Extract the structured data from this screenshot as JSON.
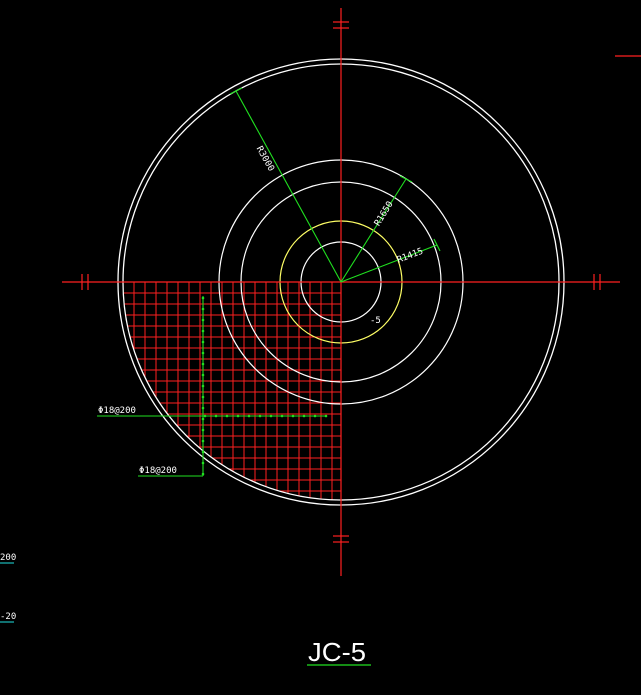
{
  "drawing": {
    "title": "JC-5",
    "colors": {
      "background": "#000000",
      "axis": "#ff2020",
      "circle": "#ffffff",
      "pile_circle": "#ffff66",
      "dimension": "#20e020",
      "rebar_grid": "#ff2020",
      "text": "#ffffff"
    },
    "dimensions": {
      "outer_radius": "R3000",
      "middle_radius": "R1650",
      "inner_radius": "R1415",
      "center_mark": "-5"
    },
    "rebar": {
      "horizontal_label": "Φ18@200",
      "vertical_label": "Φ18@200"
    },
    "margin_fragments": [
      "200",
      "-20"
    ]
  }
}
